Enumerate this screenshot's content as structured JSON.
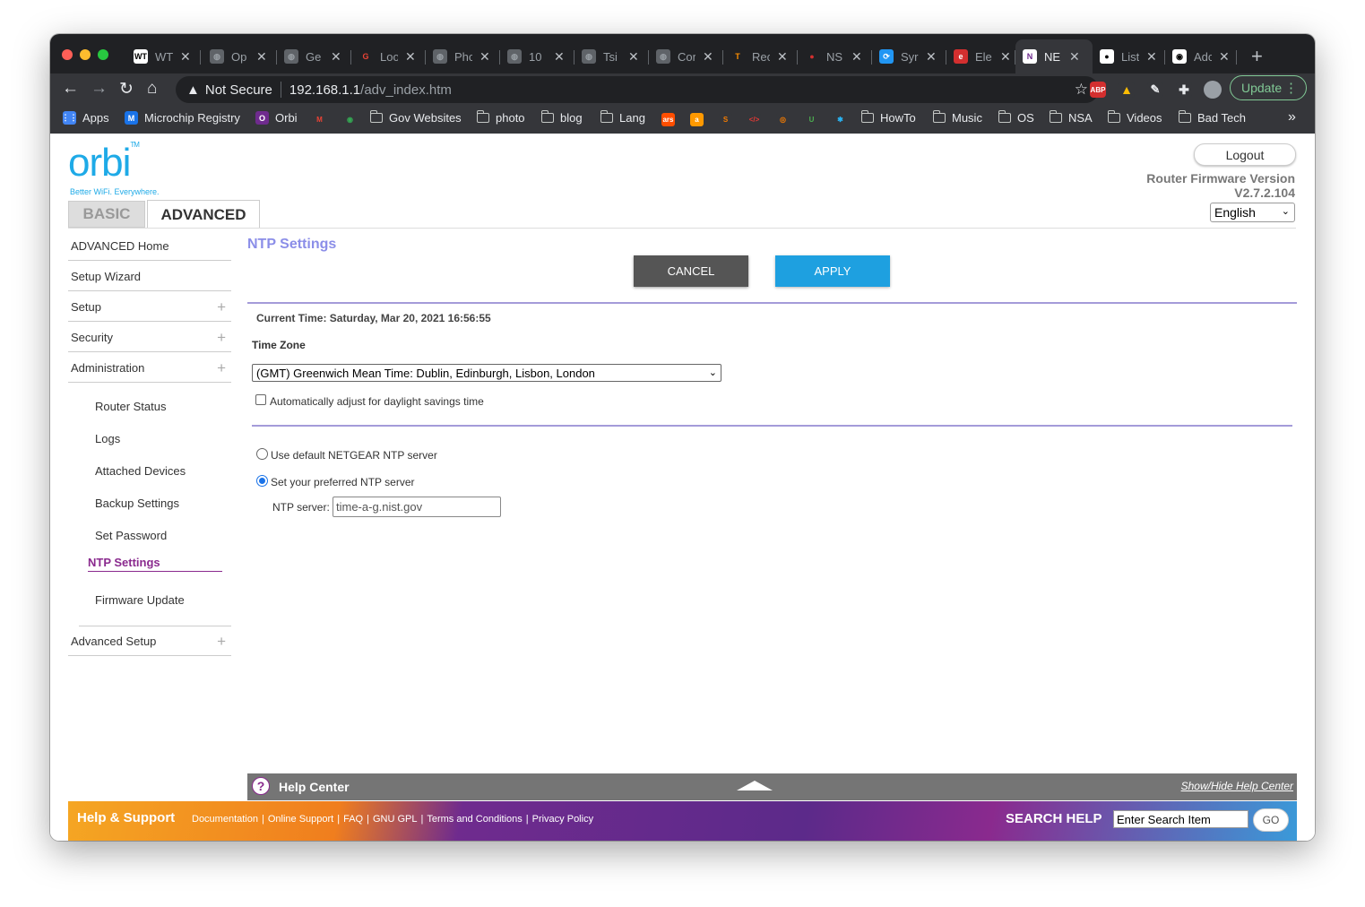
{
  "browser": {
    "tabs": [
      {
        "title": "WT",
        "favicon": "wt-icon",
        "color": "#ffffff",
        "fg": "#000000",
        "glyph": "WT"
      },
      {
        "title": "Op",
        "favicon": "globe-icon",
        "color": "#5f6368",
        "fg": "#9aa0a6",
        "glyph": "◍"
      },
      {
        "title": "Ge",
        "favicon": "globe-icon",
        "color": "#5f6368",
        "fg": "#9aa0a6",
        "glyph": "◍"
      },
      {
        "title": "Loo",
        "favicon": "google-icon",
        "color": "#202124",
        "fg": "#ea4335",
        "glyph": "G"
      },
      {
        "title": "Pho",
        "favicon": "globe-icon",
        "color": "#5f6368",
        "fg": "#9aa0a6",
        "glyph": "◍"
      },
      {
        "title": "10",
        "favicon": "globe-icon",
        "color": "#5f6368",
        "fg": "#9aa0a6",
        "glyph": "◍"
      },
      {
        "title": "Tsi",
        "favicon": "globe-icon",
        "color": "#5f6368",
        "fg": "#9aa0a6",
        "glyph": "◍"
      },
      {
        "title": "Cor",
        "favicon": "globe-icon",
        "color": "#5f6368",
        "fg": "#9aa0a6",
        "glyph": "◍"
      },
      {
        "title": "Rec",
        "favicon": "tensorflow-icon",
        "color": "#202124",
        "fg": "#ff8f00",
        "glyph": "T"
      },
      {
        "title": "NS",
        "favicon": "nsa-icon",
        "color": "#202124",
        "fg": "#d32f2f",
        "glyph": "●"
      },
      {
        "title": "Syr",
        "favicon": "sync-icon",
        "color": "#2196f3",
        "fg": "#ffffff",
        "glyph": "⟳"
      },
      {
        "title": "Ele",
        "favicon": "e-icon",
        "color": "#d32f2f",
        "fg": "#ffffff",
        "glyph": "e"
      },
      {
        "title": "NE",
        "favicon": "netgear-icon",
        "color": "#ffffff",
        "fg": "#6f2b8e",
        "glyph": "N",
        "active": true
      },
      {
        "title": "List",
        "favicon": "github-icon",
        "color": "#ffffff",
        "fg": "#000000",
        "glyph": "●"
      },
      {
        "title": "Adc",
        "favicon": "panda-icon",
        "color": "#ffffff",
        "fg": "#000000",
        "glyph": "◉"
      }
    ],
    "url": {
      "warning": "Not Secure",
      "host": "192.168.1.1",
      "path": "/adv_index.htm"
    },
    "update_label": "Update",
    "bookmarks": [
      {
        "label": "Apps",
        "type": "apps"
      },
      {
        "label": "Microchip Registry",
        "type": "microchip"
      },
      {
        "label": "Orbi",
        "type": "orbi"
      },
      {
        "label": "",
        "type": "gmail"
      },
      {
        "label": "",
        "type": "maps"
      },
      {
        "label": "Gov Websites",
        "type": "folder"
      },
      {
        "label": "photo",
        "type": "folder"
      },
      {
        "label": "blog",
        "type": "folder"
      },
      {
        "label": "Lang",
        "type": "folder"
      },
      {
        "label": "",
        "type": "ars"
      },
      {
        "label": "",
        "type": "amazon"
      },
      {
        "label": "",
        "type": "s"
      },
      {
        "label": "",
        "type": "code"
      },
      {
        "label": "",
        "type": "blender"
      },
      {
        "label": "",
        "type": "u"
      },
      {
        "label": "",
        "type": "star"
      },
      {
        "label": "HowTo",
        "type": "folder"
      },
      {
        "label": "Music",
        "type": "folder"
      },
      {
        "label": "OS",
        "type": "folder"
      },
      {
        "label": "NSA",
        "type": "folder"
      },
      {
        "label": "Videos",
        "type": "folder"
      },
      {
        "label": "Bad Tech",
        "type": "folder"
      }
    ]
  },
  "router": {
    "logo": "orbi",
    "tagline": "Better WiFi. Everywhere.",
    "logout_label": "Logout",
    "firmware_label": "Router Firmware Version",
    "firmware_version": "V2.7.2.104",
    "language": "English",
    "tabs": {
      "basic": "BASIC",
      "advanced": "ADVANCED"
    },
    "sidebar": {
      "top_items": [
        {
          "label": "ADVANCED Home",
          "expandable": false
        },
        {
          "label": "Setup Wizard",
          "expandable": false
        },
        {
          "label": "Setup",
          "expandable": true
        },
        {
          "label": "Security",
          "expandable": true
        },
        {
          "label": "Administration",
          "expandable": true
        }
      ],
      "admin_items": [
        "Router Status",
        "Logs",
        "Attached Devices",
        "Backup Settings",
        "Set Password",
        "NTP Settings",
        "Firmware Update"
      ],
      "active_item": "NTP Settings",
      "advanced_setup": "Advanced Setup"
    },
    "ntp": {
      "title": "NTP Settings",
      "cancel_label": "CANCEL",
      "apply_label": "APPLY",
      "current_time": "Current Time: Saturday, Mar 20, 2021 16:56:55",
      "time_zone_label": "Time Zone",
      "time_zone_value": "(GMT) Greenwich Mean Time: Dublin, Edinburgh, Lisbon, London",
      "dst_label": "Automatically adjust for daylight savings time",
      "dst_checked": false,
      "default_server_label": "Use default NETGEAR NTP server",
      "preferred_server_label": "Set your preferred NTP server",
      "preferred_selected": true,
      "ntp_server_label": "NTP server:",
      "ntp_server_value": "time-a-g.nist.gov"
    },
    "help": {
      "title": "Help Center",
      "toggle_label": "Show/Hide Help Center"
    },
    "footer": {
      "help_support": "Help & Support",
      "links": [
        "Documentation",
        "Online Support",
        "FAQ",
        "GNU GPL",
        "Terms and Conditions",
        "Privacy Policy"
      ],
      "search_label": "SEARCH HELP",
      "search_placeholder": "Enter Search Item",
      "go_label": "GO"
    },
    "colors": {
      "brand_blue": "#1eaae7",
      "title_purple": "#8b8ee8",
      "active_purple": "#8a2a8e",
      "apply_blue": "#1ea0e0",
      "cancel_gray": "#555555"
    }
  }
}
